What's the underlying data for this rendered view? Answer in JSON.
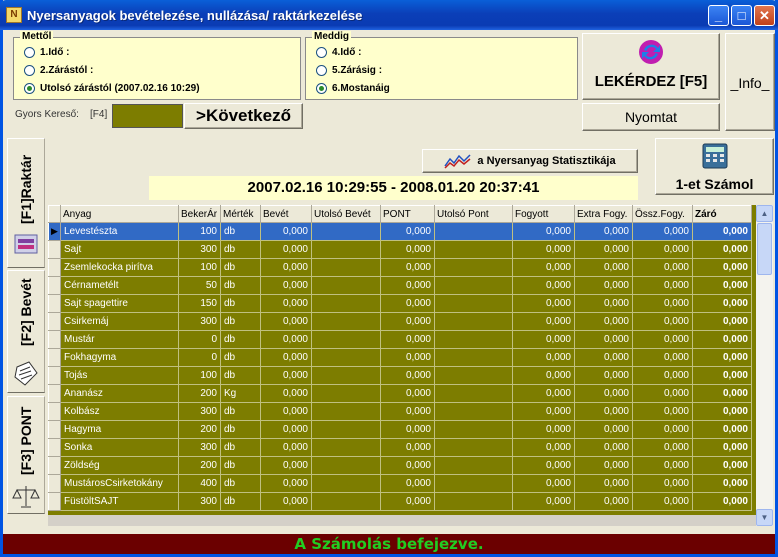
{
  "window": {
    "title": "Nyersanyagok bevételezése, nullázása/ raktárkezelése",
    "minimize": "_",
    "maximize": "□",
    "close": "✕"
  },
  "from_group": {
    "label": "Mettől",
    "options": [
      {
        "label": "1.Idő :",
        "selected": false
      },
      {
        "label": "2.Zárástól :",
        "selected": false
      },
      {
        "label": "Utolsó zárástól (2007.02.16 10:29)",
        "selected": true
      }
    ]
  },
  "to_group": {
    "label": "Meddig",
    "options": [
      {
        "label": "4.Idő :",
        "selected": false
      },
      {
        "label": "5.Zárásig :",
        "selected": false
      },
      {
        "label": "6.Mostanáig",
        "selected": true
      }
    ]
  },
  "query_button": "LEKÉRDEZ [F5]",
  "info_button": "_Info_",
  "print_button": "Nyomtat",
  "quick_search": {
    "label": "Gyors Kereső:",
    "key": "[F4]",
    "next_button": ">Következő"
  },
  "stats_button": "a Nyersanyag Statisztikája",
  "count_one_button": "1-et Számol",
  "date_range": "2007.02.16 10:29:55 - 2008.01.20 20:37:41",
  "tabs": [
    {
      "label": "[F1]Raktár"
    },
    {
      "label": "[F2] Bevét"
    },
    {
      "label": "[F3] PONT"
    }
  ],
  "table": {
    "columns": [
      "Anyag",
      "BekerÁr",
      "Mérték",
      "Bevét",
      "Utolsó Bevét",
      "PONT",
      "Utolsó Pont",
      "Fogyott",
      "Extra Fogy.",
      "Össz.Fogy.",
      "Záró"
    ],
    "rows": [
      [
        "Levestészta",
        "100",
        "db",
        "0,000",
        "",
        "0,000",
        "",
        "0,000",
        "0,000",
        "0,000",
        "0,000"
      ],
      [
        "Sajt",
        "300",
        "db",
        "0,000",
        "",
        "0,000",
        "",
        "0,000",
        "0,000",
        "0,000",
        "0,000"
      ],
      [
        "Zsemlekocka pirítva",
        "100",
        "db",
        "0,000",
        "",
        "0,000",
        "",
        "0,000",
        "0,000",
        "0,000",
        "0,000"
      ],
      [
        "Cérnametélt",
        "50",
        "db",
        "0,000",
        "",
        "0,000",
        "",
        "0,000",
        "0,000",
        "0,000",
        "0,000"
      ],
      [
        "Sajt spagettire",
        "150",
        "db",
        "0,000",
        "",
        "0,000",
        "",
        "0,000",
        "0,000",
        "0,000",
        "0,000"
      ],
      [
        "Csirkemáj",
        "300",
        "db",
        "0,000",
        "",
        "0,000",
        "",
        "0,000",
        "0,000",
        "0,000",
        "0,000"
      ],
      [
        "Mustár",
        "0",
        "db",
        "0,000",
        "",
        "0,000",
        "",
        "0,000",
        "0,000",
        "0,000",
        "0,000"
      ],
      [
        "Fokhagyma",
        "0",
        "db",
        "0,000",
        "",
        "0,000",
        "",
        "0,000",
        "0,000",
        "0,000",
        "0,000"
      ],
      [
        "Tojás",
        "100",
        "db",
        "0,000",
        "",
        "0,000",
        "",
        "0,000",
        "0,000",
        "0,000",
        "0,000"
      ],
      [
        "Ananász",
        "200",
        "Kg",
        "0,000",
        "",
        "0,000",
        "",
        "0,000",
        "0,000",
        "0,000",
        "0,000"
      ],
      [
        "Kolbász",
        "300",
        "db",
        "0,000",
        "",
        "0,000",
        "",
        "0,000",
        "0,000",
        "0,000",
        "0,000"
      ],
      [
        "Hagyma",
        "200",
        "db",
        "0,000",
        "",
        "0,000",
        "",
        "0,000",
        "0,000",
        "0,000",
        "0,000"
      ],
      [
        "Sonka",
        "300",
        "db",
        "0,000",
        "",
        "0,000",
        "",
        "0,000",
        "0,000",
        "0,000",
        "0,000"
      ],
      [
        "Zöldség",
        "200",
        "db",
        "0,000",
        "",
        "0,000",
        "",
        "0,000",
        "0,000",
        "0,000",
        "0,000"
      ],
      [
        "MustárosCsirketokány",
        "400",
        "db",
        "0,000",
        "",
        "0,000",
        "",
        "0,000",
        "0,000",
        "0,000",
        "0,000"
      ],
      [
        "FüstöltSAJT",
        "300",
        "db",
        "0,000",
        "",
        "0,000",
        "",
        "0,000",
        "0,000",
        "0,000",
        "0,000"
      ]
    ]
  },
  "status": "A Számolás befejezve.",
  "colors": {
    "grid_bg": "#7d7d00",
    "selected_row": "#316ac5",
    "status_bg": "#6b0000",
    "status_text": "#22cc22"
  }
}
